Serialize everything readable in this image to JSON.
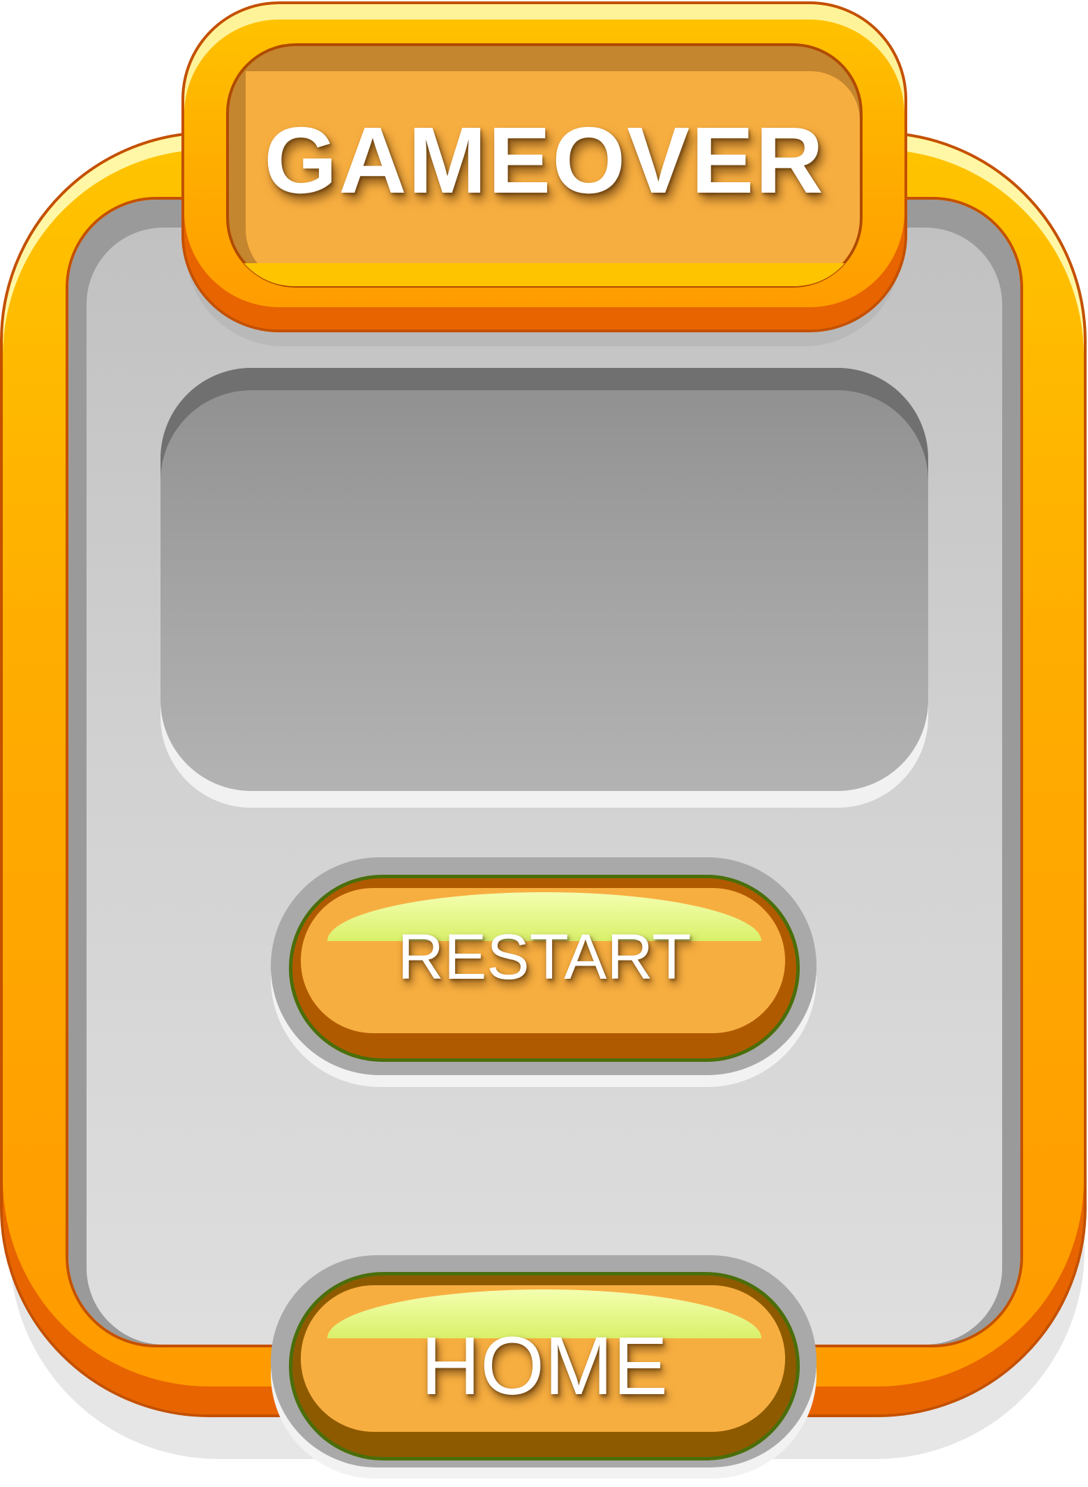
{
  "title": {
    "text": "GAMEOVER"
  },
  "buttons": {
    "restart_label": "RESTART",
    "home_label": "HOME"
  },
  "colors": {
    "frame_orange": "#ffad00",
    "frame_outline": "#c45000",
    "panel_grey": "#d2d2d2",
    "button_face": "#f7ae40",
    "button_outline": "#4a6e0a",
    "button_gloss": "#d9f06a"
  }
}
